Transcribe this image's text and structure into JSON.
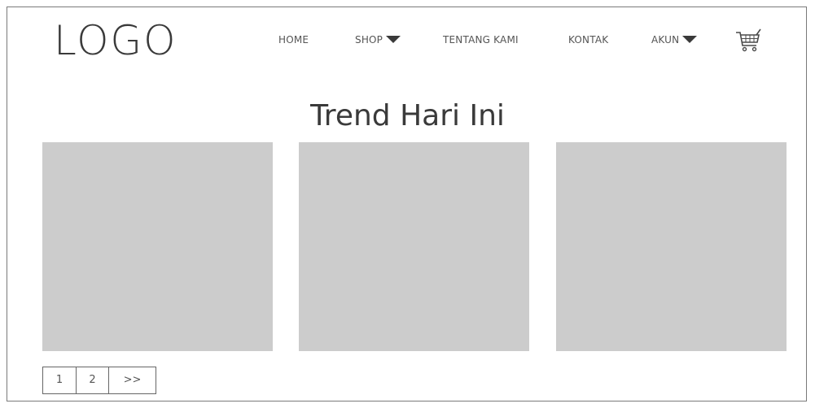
{
  "header": {
    "logo": "LOGO",
    "nav": {
      "home": "HOME",
      "shop": "SHOP",
      "tentang_kami": "TENTANG KAMI",
      "kontak": "KONTAK",
      "akun": "AKUN"
    },
    "cart_icon": "cart-icon"
  },
  "main": {
    "title": "Trend Hari Ini",
    "tiles": [
      {
        "type": "image-placeholder"
      },
      {
        "type": "image-placeholder"
      },
      {
        "type": "image-placeholder"
      }
    ],
    "pagination": {
      "pages": [
        "1",
        "2"
      ],
      "next": ">>"
    }
  },
  "colors": {
    "placeholder": "#cccccc",
    "text": "#444444",
    "border": "#7a7a7a"
  }
}
